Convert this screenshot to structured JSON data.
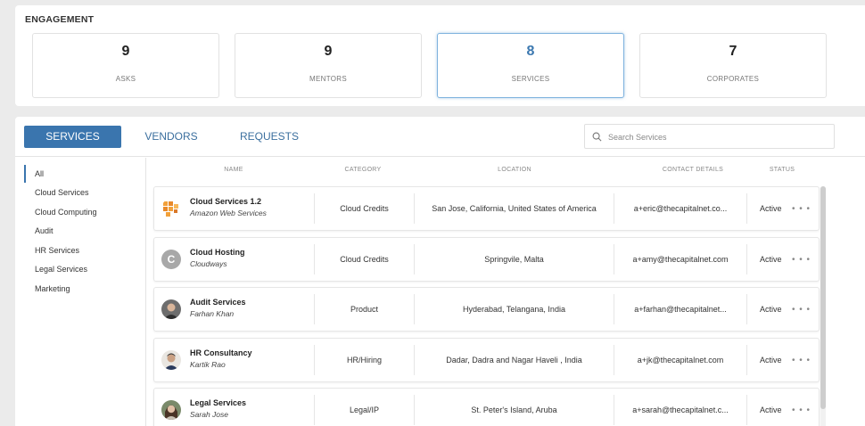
{
  "engagement": {
    "title": "ENGAGEMENT",
    "stats": [
      {
        "value": "9",
        "label": "ASKS"
      },
      {
        "value": "9",
        "label": "MENTORS"
      },
      {
        "value": "8",
        "label": "SERVICES"
      },
      {
        "value": "7",
        "label": "CORPORATES"
      }
    ]
  },
  "tabs": [
    "SERVICES",
    "VENDORS",
    "REQUESTS"
  ],
  "search": {
    "placeholder": "Search Services"
  },
  "sidebar": [
    "All",
    "Cloud Services",
    "Cloud Computing",
    "Audit",
    "HR Services",
    "Legal Services",
    "Marketing"
  ],
  "table": {
    "headers": [
      "NAME",
      "CATEGORY",
      "LOCATION",
      "CONTACT DETAILS",
      "STATUS"
    ],
    "rows": [
      {
        "title": "Cloud Services 1.2",
        "sub": "Amazon Web Services",
        "category": "Cloud Credits",
        "location": "San Jose,  California, United States of America",
        "contact": "a+eric@thecapitalnet.co...",
        "status": "Active",
        "avatar": "aws-logo-icon"
      },
      {
        "title": "Cloud Hosting",
        "sub": "Cloudways",
        "category": "Cloud Credits",
        "location": "Springvile, Malta",
        "contact": "a+amy@thecapitalnet.com",
        "status": "Active",
        "avatar": "letter-c-avatar",
        "avatar_letter": "C"
      },
      {
        "title": "Audit Services",
        "sub": "Farhan Khan",
        "category": "Product",
        "location": "Hyderabad, Telangana, India",
        "contact": "a+farhan@thecapitalnet...",
        "status": "Active",
        "avatar": "person-avatar"
      },
      {
        "title": "HR Consultancy",
        "sub": "Kartik Rao",
        "category": "HR/Hiring",
        "location": "Dadar, Dadra and Nagar Haveli , India",
        "contact": "a+jk@thecapitalnet.com",
        "status": "Active",
        "avatar": "person-avatar"
      },
      {
        "title": "Legal Services",
        "sub": "Sarah Jose",
        "category": "Legal/IP",
        "location": "St. Peter's Island, Aruba",
        "contact": "a+sarah@thecapitalnet.c...",
        "status": "Active",
        "avatar": "person-avatar"
      }
    ],
    "more_glyph": "• • •"
  },
  "colors": {
    "accent": "#3a75ae",
    "active_stat": "#3b78b0"
  }
}
